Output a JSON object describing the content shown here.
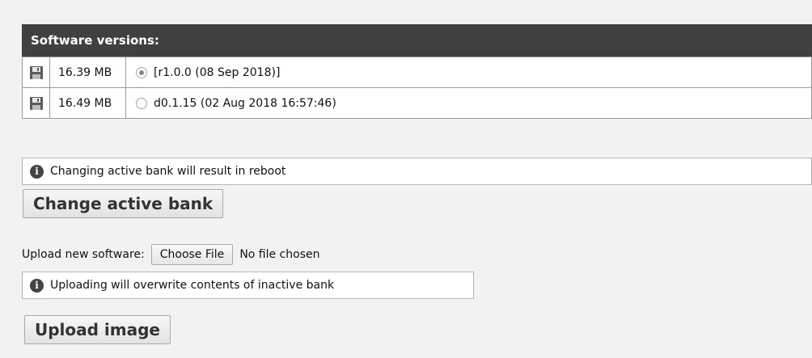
{
  "panel": {
    "title": "Software versions:"
  },
  "versions": [
    {
      "size": "16.39 MB",
      "label": "[r1.0.0 (08 Sep 2018)]",
      "selected": true,
      "icon": "save-icon"
    },
    {
      "size": "16.49 MB",
      "label": "d0.1.15 (02 Aug 2018 16:57:46)",
      "selected": false,
      "icon": "save-icon"
    }
  ],
  "bank_notice": {
    "icon": "info-icon",
    "text": "Changing active bank will result in reboot"
  },
  "change_bank_button": {
    "label": "Change active bank"
  },
  "upload": {
    "label": "Upload new software:",
    "choose_button": "Choose File",
    "file_status": "No file chosen",
    "notice": {
      "icon": "info-icon",
      "text": "Uploading will overwrite contents of inactive bank"
    },
    "upload_button": "Upload image"
  },
  "colors": {
    "header_bg": "#404040",
    "page_bg": "#f2f2f2"
  }
}
